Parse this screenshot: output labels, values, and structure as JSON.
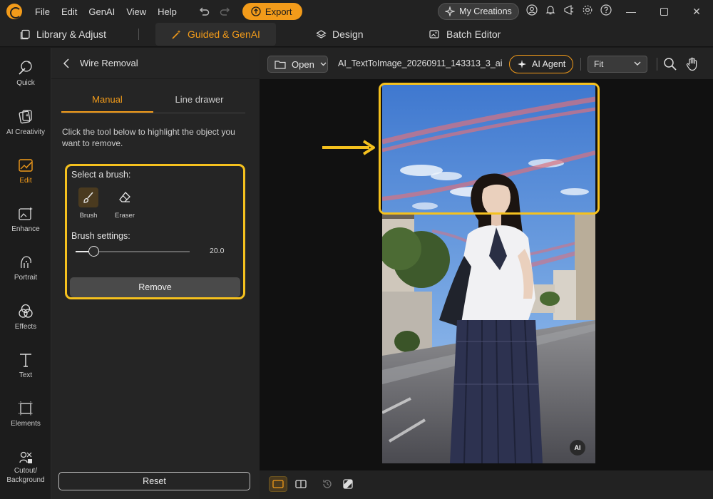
{
  "titlebar": {
    "menu": [
      "File",
      "Edit",
      "GenAI",
      "View",
      "Help"
    ],
    "export_label": "Export",
    "my_creations_label": "My Creations"
  },
  "nav": {
    "tabs": [
      {
        "label": "Library & Adjust",
        "icon": "library-icon"
      },
      {
        "label": "Guided & GenAI",
        "icon": "magic-wand-icon",
        "active": true
      },
      {
        "label": "Design",
        "icon": "layers-icon"
      },
      {
        "label": "Batch Editor",
        "icon": "images-icon"
      }
    ]
  },
  "rail": {
    "items": [
      {
        "label": "Quick",
        "icon": "quick-wand-icon"
      },
      {
        "label": "AI Creativity",
        "icon": "ai-creativity-icon"
      },
      {
        "label": "Edit",
        "icon": "edit-image-icon",
        "active": true
      },
      {
        "label": "Enhance",
        "icon": "enhance-icon"
      },
      {
        "label": "Portrait",
        "icon": "portrait-icon"
      },
      {
        "label": "Effects",
        "icon": "effects-icon"
      },
      {
        "label": "Text",
        "icon": "text-icon"
      },
      {
        "label": "Elements",
        "icon": "elements-icon"
      },
      {
        "label": "Cutout/",
        "label2": "Background",
        "icon": "cutout-icon"
      }
    ]
  },
  "panel": {
    "title": "Wire Removal",
    "tabs": [
      "Manual",
      "Line drawer"
    ],
    "active_tab": "Manual",
    "instruction": "Click the tool below to highlight the object you want to remove.",
    "select_brush_label": "Select a brush:",
    "tools": [
      {
        "label": "Brush",
        "icon": "brush-icon",
        "active": true
      },
      {
        "label": "Eraser",
        "icon": "eraser-icon"
      }
    ],
    "brush_settings_label": "Brush settings:",
    "brush_size_value": "20.0",
    "brush_size_fraction": 0.16,
    "remove_label": "Remove",
    "reset_label": "Reset"
  },
  "workspace": {
    "open_label": "Open",
    "file_name": "AI_TextToImage_20260911_143313_3_ai....",
    "ai_agent_label": "AI Agent",
    "zoom_value": "Fit",
    "badge_text": "AI"
  },
  "colors": {
    "accent": "#f29b1a",
    "highlight": "#f5c11e",
    "wire_mask": "#d9727f"
  }
}
